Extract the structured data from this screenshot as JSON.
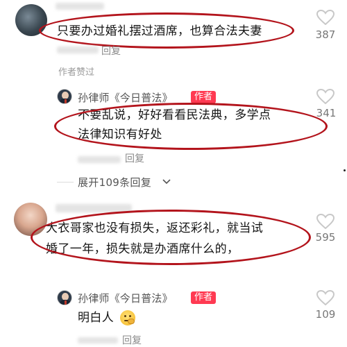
{
  "comments": [
    {
      "text": "只要办过婚礼摆过酒席，也算合法夫妻",
      "reply_label": "回复",
      "author_liked": "作者赞过",
      "likes": "387",
      "reply": {
        "author": "孙律师《今日普法》",
        "badge": "作者",
        "text_line1": "不要乱说，好好看看民法典，多学点",
        "text_line2": "法律知识有好处",
        "reply_label": "回复",
        "likes": "341"
      },
      "expand_label": "展开109条回复"
    },
    {
      "text_line1": "大衣哥家也没有损失，返还彩礼，就当试",
      "text_line2": "婚了一年，损失就是办酒席什么的，",
      "likes": "595",
      "reply": {
        "author": "孙律师《今日普法》",
        "badge": "作者",
        "text": "明白人",
        "emoji": "thinking-face-emoji",
        "reply_label": "回复",
        "likes": "109"
      }
    }
  ],
  "colors": {
    "highlight_oval": "#b3141c",
    "author_badge": "#ff3a52",
    "heart_outline": "#c8c8c8"
  }
}
